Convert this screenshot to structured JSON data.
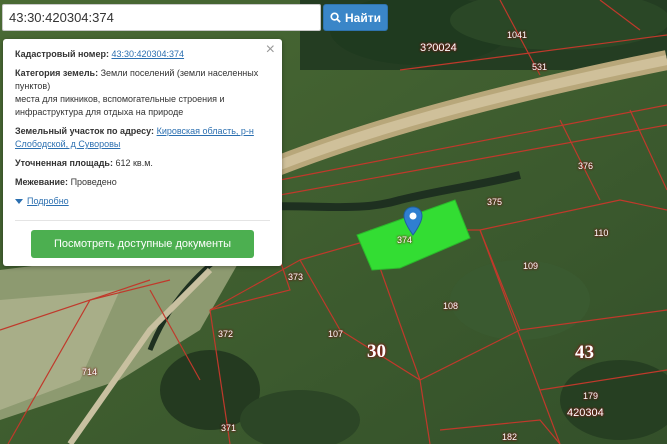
{
  "search": {
    "value": "43:30:420304:374",
    "button_label": "Найти"
  },
  "popup": {
    "cadastral_label": "Кадастровый номер:",
    "cadastral_value": "43:30:420304:374",
    "category_label": "Категория земель:",
    "category_value": "Земли поселений (земли населенных пунктов)",
    "category_note": "места для пикников, вспомогательные строения и инфраструктура для отдыха на природе",
    "address_label": "Земельный участок по адресу:",
    "address_value": "Кировская область, р-н Слободской, д Суворовы",
    "area_label": "Уточненная площадь:",
    "area_value": "612 кв.м.",
    "survey_label": "Межевание:",
    "survey_value": "Проведено",
    "more_link": "Подробно",
    "docs_button": "Посмотреть доступные документы",
    "close_glyph": "×"
  },
  "map": {
    "parcel_labels": {
      "p1041": "1041",
      "p531": "531",
      "p376": "376",
      "p375": "375",
      "p110": "110",
      "p109": "109",
      "p108": "108",
      "p107": "107",
      "p373": "373",
      "p372": "372",
      "p374": "374",
      "p714": "714",
      "p371": "371",
      "p179": "179",
      "p182": "182"
    },
    "quarter_top": "3?0024",
    "quarter_bottom": "420304",
    "big_30": "30",
    "big_43": "43",
    "colors": {
      "boundary": "#c0392b",
      "selected": "#33dd33",
      "button_blue": "#3a86c8",
      "button_green": "#4caf50"
    }
  },
  "icons": [
    "search-icon",
    "close-icon",
    "triangle-down-icon",
    "map-marker-icon"
  ]
}
